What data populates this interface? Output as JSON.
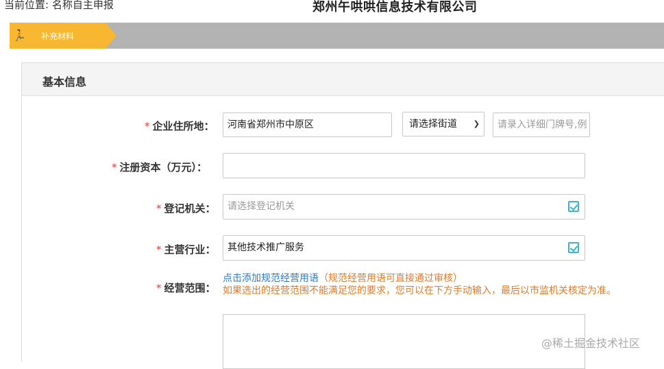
{
  "header": {
    "location": "当前位置: 名称自主申报",
    "company": "郑州午哄哄信息技术有限公司"
  },
  "steps": [
    {
      "label": "补充材料",
      "icon": "runner-icon",
      "active": true
    }
  ],
  "panel": {
    "title": "基本信息"
  },
  "form": {
    "required_mark": "*",
    "address": {
      "label": "企业住所地：",
      "value": "河南省郑州市中原区",
      "street_select": "请选择街道",
      "detail_placeholder": "请录入详细门牌号,例"
    },
    "capital": {
      "label": "注册资本（万元）：",
      "value": ""
    },
    "registry": {
      "label": "登记机关：",
      "placeholder": "请选择登记机关",
      "icon": "select-check-icon"
    },
    "industry": {
      "label": "主营行业：",
      "value": "其他技术推广服务",
      "icon": "select-check-icon"
    },
    "scope": {
      "label": "经营范围：",
      "link": "点击添加规范经营用语",
      "hint": "（规范经营用语可直接通过审核）",
      "note": "如果选出的经营范围不能满足您的要求，您可以在下方手动输入，最后以市监机关核定为准。",
      "textarea_value": ""
    }
  },
  "watermark": "@稀土掘金技术社区",
  "colors": {
    "accent": "#f7b731",
    "step_bar": "#b3b3b3",
    "required": "#e23b3b",
    "link": "#2f79c4",
    "warning": "#e07a2a",
    "icon": "#3bb3c8"
  }
}
